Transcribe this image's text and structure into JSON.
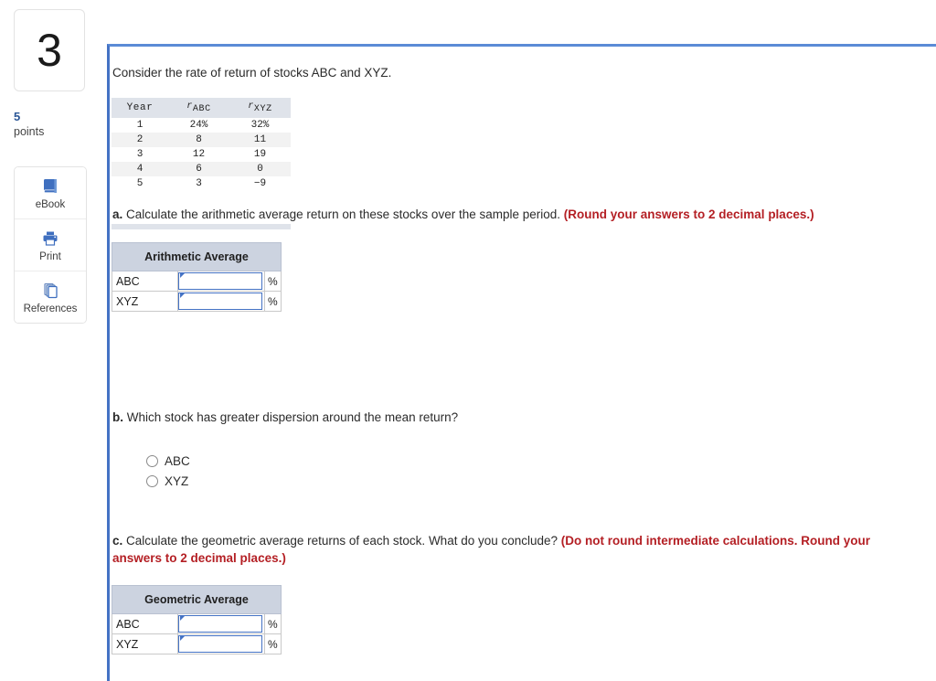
{
  "sidebar": {
    "question_number": "3",
    "points_value": "5",
    "points_label": "points",
    "tools": [
      {
        "label": "eBook",
        "icon": "book-icon"
      },
      {
        "label": "Print",
        "icon": "printer-icon"
      },
      {
        "label": "References",
        "icon": "pages-icon"
      }
    ]
  },
  "content": {
    "intro": "Consider the rate of return of stocks ABC and XYZ.",
    "returns_table": {
      "headers": [
        "Year",
        "r",
        "r"
      ],
      "header_subscripts": [
        "",
        "ABC",
        "XYZ"
      ],
      "rows": [
        [
          "1",
          "24%",
          "32%"
        ],
        [
          "2",
          "8",
          "11"
        ],
        [
          "3",
          "12",
          "19"
        ],
        [
          "4",
          "6",
          "0"
        ],
        [
          "5",
          "3",
          "−9"
        ]
      ]
    },
    "part_a": {
      "letter": "a.",
      "text": " Calculate the arithmetic average return on these stocks over the sample period. ",
      "hint": "(Round your answers to 2 decimal places.)",
      "table": {
        "header": "Arithmetic Average",
        "rows": [
          {
            "label": "ABC",
            "value": "",
            "unit": "%"
          },
          {
            "label": "XYZ",
            "value": "",
            "unit": "%"
          }
        ]
      }
    },
    "part_b": {
      "letter": "b.",
      "text": " Which stock has greater dispersion around the mean return?",
      "options": [
        {
          "label": "ABC",
          "selected": false
        },
        {
          "label": "XYZ",
          "selected": false
        }
      ]
    },
    "part_c": {
      "letter": "c.",
      "text": " Calculate the geometric average returns of each stock. What do you conclude? ",
      "hint": "(Do not round intermediate calculations. Round your answers to 2 decimal places.)",
      "table": {
        "header": "Geometric Average",
        "rows": [
          {
            "label": "ABC",
            "value": "",
            "unit": "%"
          },
          {
            "label": "XYZ",
            "value": "",
            "unit": "%"
          }
        ]
      }
    }
  },
  "colors": {
    "panel_border": "#4472c4",
    "hint_red": "#b41f24",
    "points_blue": "#2b5797",
    "table_header_grey": "#dfe3ea",
    "answer_header_blue": "#ccd3e0"
  }
}
